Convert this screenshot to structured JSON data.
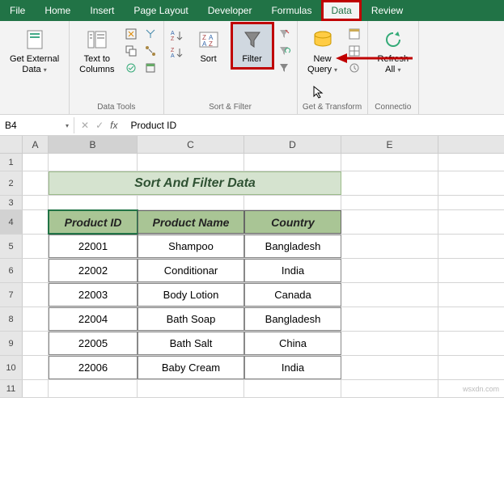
{
  "tabs": {
    "file": "File",
    "home": "Home",
    "insert": "Insert",
    "page_layout": "Page Layout",
    "developer": "Developer",
    "formulas": "Formulas",
    "data": "Data",
    "review": "Review"
  },
  "ribbon": {
    "get_external": {
      "label": "Get External\nData",
      "arrow": "▾"
    },
    "text_to_columns": "Text to\nColumns",
    "data_tools_label": "Data Tools",
    "sort": "Sort",
    "filter": "Filter",
    "sort_filter_label": "Sort & Filter",
    "new_query": {
      "label": "New\nQuery",
      "arrow": "▾"
    },
    "get_transform_label": "Get & Transform",
    "refresh_all": {
      "label": "Refresh\nAll",
      "arrow": "▾"
    },
    "connections_label": "Connectio"
  },
  "name_box": {
    "value": "B4",
    "arrow": "▾"
  },
  "fx": {
    "x": "✕",
    "check": "✓",
    "fx": "fx"
  },
  "formula_value": "Product ID",
  "columns": {
    "a": "A",
    "b": "B",
    "c": "C",
    "d": "D",
    "e": "E"
  },
  "rows": [
    "1",
    "2",
    "3",
    "4",
    "5",
    "6",
    "7",
    "8",
    "9",
    "10",
    "11"
  ],
  "title": "Sort And Filter Data",
  "table": {
    "headers": {
      "id": "Product ID",
      "name": "Product Name",
      "country": "Country"
    },
    "rows": [
      {
        "id": "22001",
        "name": "Shampoo",
        "country": "Bangladesh"
      },
      {
        "id": "22002",
        "name": "Conditionar",
        "country": "India"
      },
      {
        "id": "22003",
        "name": "Body Lotion",
        "country": "Canada"
      },
      {
        "id": "22004",
        "name": "Bath Soap",
        "country": "Bangladesh"
      },
      {
        "id": "22005",
        "name": "Bath Salt",
        "country": "China"
      },
      {
        "id": "22006",
        "name": "Baby Cream",
        "country": "India"
      }
    ]
  },
  "watermark": "wsxdn.com"
}
